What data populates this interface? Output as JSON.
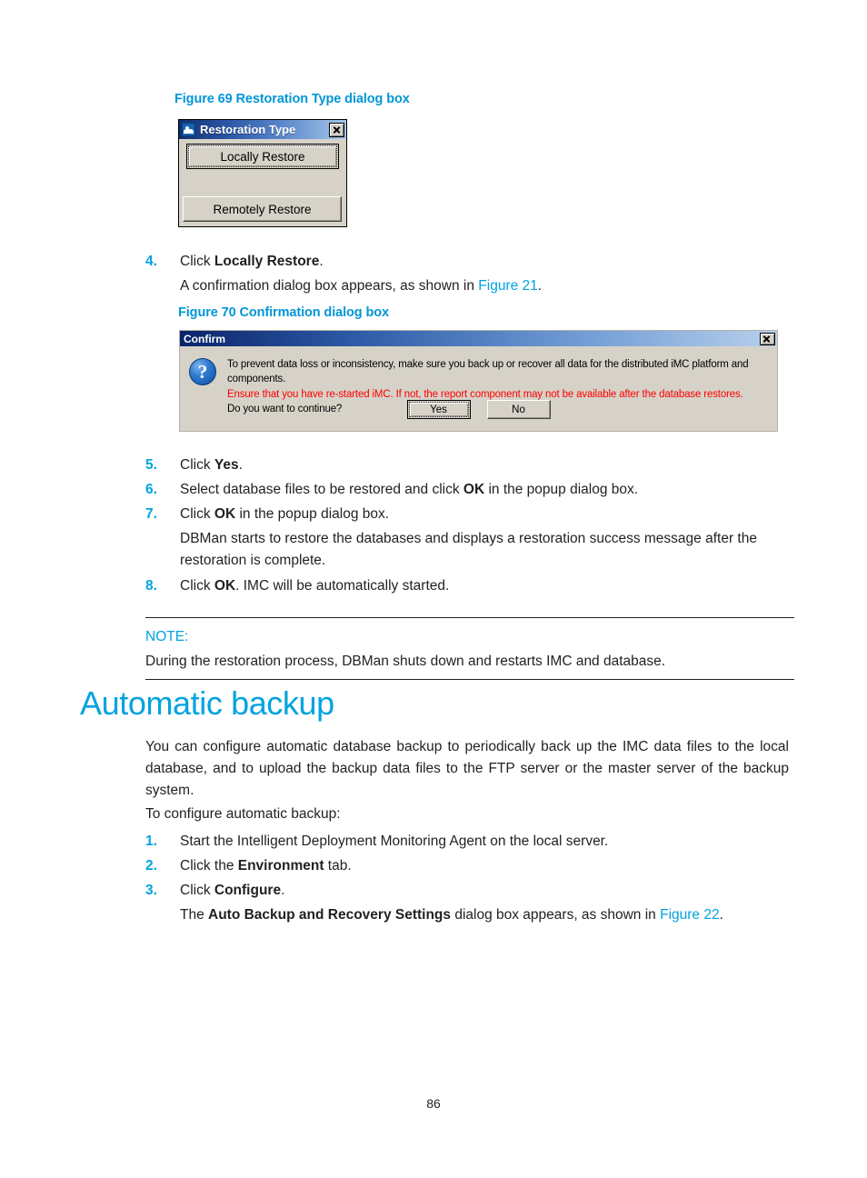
{
  "page": {
    "number": "86"
  },
  "figure69": {
    "caption": "Figure 69 Restoration Type dialog box",
    "dialog": {
      "title": "Restoration Type",
      "icon": "app-icon",
      "close_label": "X",
      "buttons": {
        "locally_restore": "Locally Restore",
        "remotely_restore": "Remotely Restore"
      }
    }
  },
  "steps_restore": {
    "step4": {
      "num": "4.",
      "text_before": "Click ",
      "bold": "Locally Restore",
      "text_after": ".",
      "sub_before": "A confirmation dialog box appears, as shown in ",
      "sub_xref": "Figure 21",
      "sub_after": "."
    },
    "step5": {
      "num": "5.",
      "text_before": "Click ",
      "bold": "Yes",
      "text_after": "."
    },
    "step6": {
      "num": "6.",
      "text_before": "Select database files to be restored and click ",
      "bold": "OK",
      "text_after": " in the popup dialog box."
    },
    "step7": {
      "num": "7.",
      "text_before": "Click ",
      "bold": "OK",
      "text_after": " in the popup dialog box.",
      "sub": "DBMan starts to restore the databases and displays a restoration success message after the restoration is complete."
    },
    "step8": {
      "num": "8.",
      "text_before": "Click ",
      "bold": "OK",
      "text_after": ". IMC will be automatically started."
    }
  },
  "figure70": {
    "caption": "Figure 70 Confirmation dialog box",
    "dialog": {
      "title": "Confirm",
      "icon": "question-icon",
      "close_label": "X",
      "line1": "To prevent data loss or inconsistency, make sure you back up or recover all data for the distributed iMC platform and components.",
      "line2_warning": "Ensure that you have re-started iMC. If not, the report component may not be available after the database restores.",
      "line3": "Do you want to continue?",
      "buttons": {
        "yes": "Yes",
        "no": "No"
      }
    }
  },
  "note": {
    "label": "NOTE:",
    "text": "During the restoration process, DBMan shuts down and restarts IMC and database."
  },
  "section": {
    "title": "Automatic backup",
    "intro": "You can configure automatic database backup to periodically back up the IMC data files to the local database, and to upload the backup data files to the FTP server or the master server of the backup system.",
    "lead_in": "To configure automatic backup:",
    "step1": {
      "num": "1.",
      "text": "Start the Intelligent Deployment Monitoring Agent on the local server."
    },
    "step2": {
      "num": "2.",
      "text_before": "Click the ",
      "bold": "Environment",
      "text_after": " tab."
    },
    "step3": {
      "num": "3.",
      "text_before": "Click ",
      "bold": "Configure",
      "text_after": ".",
      "sub_before": "The ",
      "sub_bold": "Auto Backup and Recovery Settings",
      "sub_mid": " dialog box appears, as shown in ",
      "sub_xref": "Figure 22",
      "sub_after": "."
    }
  },
  "colors": {
    "accent": "#00a3e0",
    "caption": "#0096d6",
    "warning": "#ff0000",
    "dialog_face": "#d6d2c8",
    "title_bar_start": "#0a246a",
    "title_bar_end": "#b8d0ec"
  }
}
